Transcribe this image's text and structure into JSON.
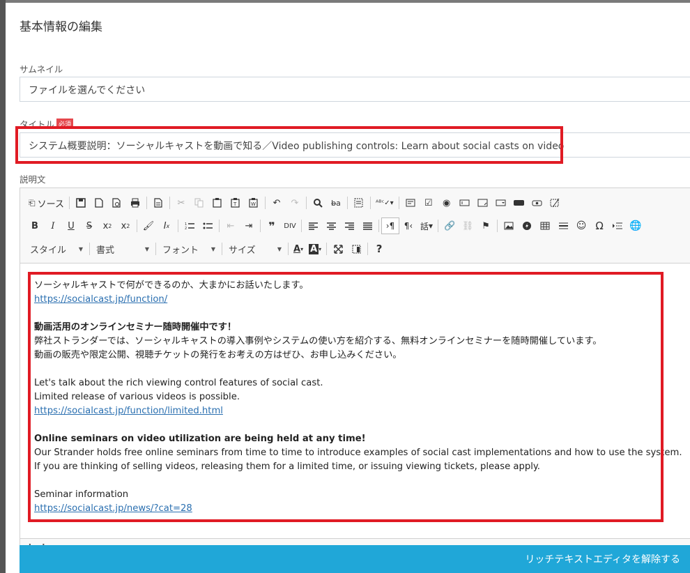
{
  "modal": {
    "title": "基本情報の編集"
  },
  "thumbnail": {
    "label": "サムネイル",
    "placeholder": "ファイルを選んでください"
  },
  "title_field": {
    "label": "タイトル",
    "required_badge": "必須",
    "value": "システム概要説明：ソーシャルキャストを動画で知る／Video publishing controls: Learn about social casts on video"
  },
  "description": {
    "label": "説明文"
  },
  "toolbar": {
    "source_label": "ソース",
    "style_label": "スタイル",
    "format_label": "書式",
    "font_label": "フォント",
    "size_label": "サイズ",
    "text_kanji": "話"
  },
  "content": {
    "line1": "ソーシャルキャストで何ができるのか、大まかにお話いたします。",
    "link1": "https://socialcast.jp/function/",
    "heading_jp": "動画活用のオンラインセミナー随時開催中です！",
    "para_jp1": "弊社ストランダーでは、ソーシャルキャストの導入事例やシステムの使い方を紹介する、無料オンラインセミナーを随時開催しています。",
    "para_jp2": "動画の販売や限定公開、視聴チケットの発行をお考えの方はぜひ、お申し込みください。",
    "en1": "Let's talk about the rich viewing control features of social cast.",
    "en2": "Limited release of various videos is possible.",
    "link2": "https://socialcast.jp/function/limited.html",
    "heading_en": "Online seminars on video utilization are being held at any time!",
    "para_en1": "Our Strander holds free online seminars from time to time to introduce examples of social cast implementations and how to use the system.",
    "para_en2": "If you are thinking of selling videos, releasing them for a limited time, or issuing viewing tickets, please apply.",
    "seminar": "Seminar information",
    "link3": "https://socialcast.jp/news/?cat=28"
  },
  "statusbar": {
    "path": "body"
  },
  "footer": {
    "button_label": "リッチテキストエディタを解除する"
  },
  "colors": {
    "accent": "#20a7d8",
    "highlight": "#e01b24",
    "link": "#2a6fb0",
    "required": "#e5484d"
  }
}
